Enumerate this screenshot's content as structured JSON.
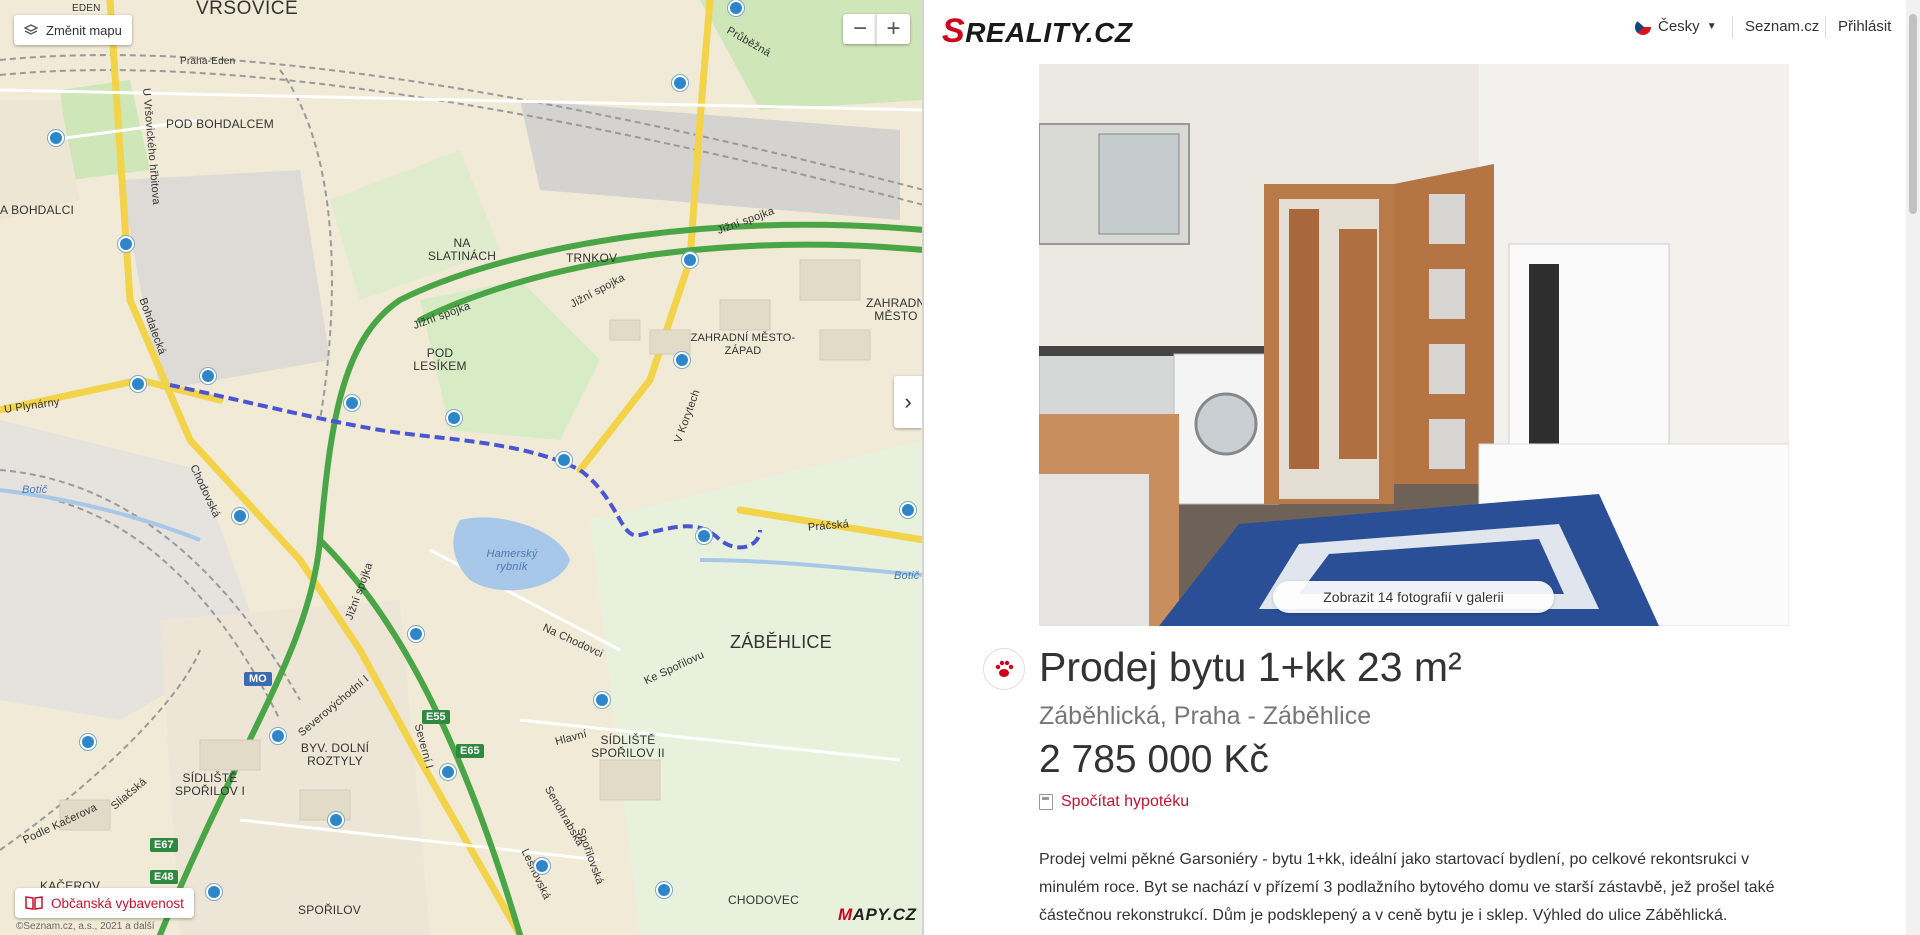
{
  "map": {
    "change_map_label": "Změnit mapu",
    "zoom_out_label": "−",
    "zoom_in_label": "+",
    "collapse_label": "›",
    "amenities_label": "Občanská vybavenost",
    "logo_m": "M",
    "logo_rest": "APY.CZ",
    "copyright": "©Seznam.cz, a.s., 2021 a další",
    "labels": {
      "vrsovice": "VRŠOVICE",
      "eden": "EDEN",
      "praha_eden": "Praha-Eden",
      "pod_bohdalcem": "POD BOHDALCEM",
      "na_bohdalci": "A BOHDALCI",
      "na_slatinach": "NA SLATINÁCH",
      "trnkov": "TRNKOV",
      "pod_lesikem": "POD LESÍKEM",
      "zahradni_mesto_zapad": "ZAHRADNÍ MĚSTO-ZÁPAD",
      "zahradni_mesto": "ZAHRADNÍ MĚSTO",
      "zabehlice": "ZÁBĚHLICE",
      "byv_dolni_roztyly": "BYV. DOLNÍ ROZTYLY",
      "sidliste_sporilov_ii": "SÍDLIŠTĚ SPOŘILOV II",
      "sidliste_sporilov_i": "SÍDLIŠTĚ SPOŘILOV I",
      "sporilov": "SPOŘILOV",
      "chodovec": "CHODOVEC",
      "kacerov": "KAČEROV",
      "hamersky": "Hamerský rybník",
      "botic": "Botič",
      "botic2": "Botič",
      "jizni_spojka1": "Jižní spojka",
      "jizni_spojka2": "Jižní spojka",
      "jizni_spojka3": "Jižní spojka",
      "jizni_spojka4": "Jižní spojka",
      "v_korytech": "V Korytech",
      "bohdalecka": "Bohdalecká",
      "chodovska": "Chodovská",
      "u_plynarny": "U Plynárny",
      "na_chodovci": "Na Chodovci",
      "hlavni": "Hlavní",
      "prubezna": "Průběžná",
      "pracska": "Práčská",
      "u_vrsovickeho_hrbitova": "U Vršovického hřbitova",
      "severovychodni": "Severovýchodní I",
      "ke_sporilovu": "Ke Spořilovu",
      "sliacska": "Sliačská",
      "podle_kacerova": "Podle Kačerova",
      "senohrabska": "Senohrabská",
      "spolupracovska": "Spořilovská",
      "lesnovska": "Lešnovská",
      "severni": "Severní I"
    },
    "badges": [
      "MO",
      "E55",
      "E65",
      "E67",
      "E48"
    ]
  },
  "header": {
    "logo_s": "S",
    "logo_rest": "REALITY.CZ",
    "language": "Česky",
    "seznam_link": "Seznam.cz",
    "login_link": "Přihlásit"
  },
  "listing": {
    "gallery_button": "Zobrazit 14 fotografií v galerii",
    "title": "Prodej bytu 1+kk 23 m²",
    "address": "Záběhlická, Praha - Záběhlice",
    "price": "2 785 000 Kč",
    "mortgage_link": "Spočítat hypotéku",
    "description": "Prodej velmi pěkné Garsoniéry - bytu 1+kk, ideální jako startovací bydlení, po celkové rekontsrukci v minulém roce. Byt se nachází v přízemí 3 podlažního bytového domu ve starší zástavbě, jež prošel také částečnou rekonstrukcí. Dům je podsklepený a v ceně bytu je i sklep. Výhled do ulice Záběhlická."
  },
  "colors": {
    "brand_red": "#d0021b",
    "link_red": "#c8102e",
    "route_blue": "#4a55d6",
    "map_bg": "#f1ead6"
  }
}
